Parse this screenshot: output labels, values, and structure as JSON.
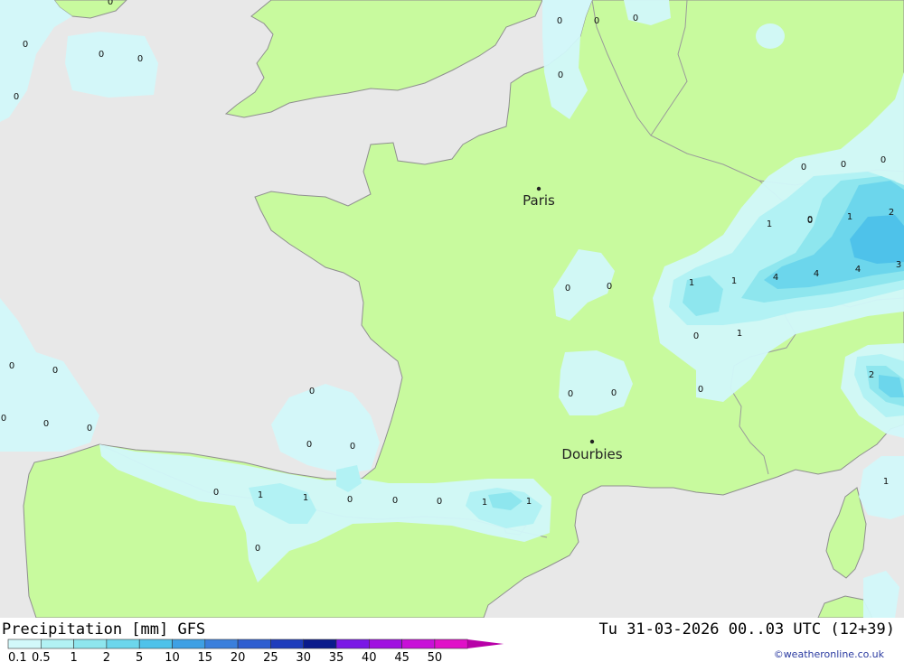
{
  "colors": {
    "sea": "#e8e8e8",
    "land": "#c8fa9e",
    "precip_levels": [
      "#d2f8fa",
      "#b2f2f4",
      "#8ee6ee",
      "#6cd6ec",
      "#4ec2ea",
      "#3ea0e4",
      "#3a7fdc",
      "#2e5ed0",
      "#1e3cbc",
      "#0a1a8c",
      "#7a18e6",
      "#a010e0",
      "#c810d8",
      "#e010c8",
      "#b800a8"
    ]
  },
  "map": {
    "cities": [
      {
        "name": "Paris"
      },
      {
        "name": "Dourbies"
      }
    ],
    "values": [
      "0",
      "0",
      "0",
      "0",
      "0",
      "0",
      "0",
      "0",
      "0",
      "0",
      "0",
      "0",
      "0",
      "0",
      "0",
      "0",
      "0",
      "1",
      "0",
      "1",
      "2",
      "1",
      "1",
      "4",
      "4",
      "4",
      "3",
      "0",
      "1",
      "0",
      "2",
      "0",
      "0",
      "0",
      "0",
      "0",
      "0",
      "0",
      "0",
      "0",
      "1",
      "1",
      "0",
      "0",
      "0",
      "1",
      "1",
      "0",
      "1"
    ]
  },
  "footer": {
    "title": "Precipitation [mm] GFS",
    "datetime": "Tu 31-03-2026 00..03 UTC (12+39)",
    "credit": "©weatheronline.co.uk",
    "legend_ticks": [
      "0.1",
      "0.5",
      "1",
      "2",
      "5",
      "10",
      "15",
      "20",
      "25",
      "30",
      "35",
      "40",
      "45",
      "50"
    ]
  }
}
